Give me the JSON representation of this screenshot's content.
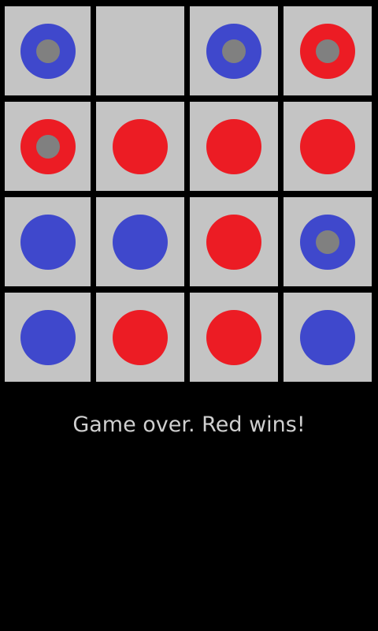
{
  "colors": {
    "background": "#000000",
    "cell": "#c4c4c4",
    "red": "#ec1c24",
    "blue": "#3f48cc",
    "marker": "#808080",
    "status_text": "#cfcfcf"
  },
  "board": {
    "rows": 4,
    "cols": 4,
    "cells": [
      [
        {
          "piece": "blue",
          "marked": true
        },
        {
          "piece": "empty",
          "marked": false
        },
        {
          "piece": "blue",
          "marked": true
        },
        {
          "piece": "red",
          "marked": true
        }
      ],
      [
        {
          "piece": "red",
          "marked": true
        },
        {
          "piece": "red",
          "marked": false
        },
        {
          "piece": "red",
          "marked": false
        },
        {
          "piece": "red",
          "marked": false
        }
      ],
      [
        {
          "piece": "blue",
          "marked": false
        },
        {
          "piece": "blue",
          "marked": false
        },
        {
          "piece": "red",
          "marked": false
        },
        {
          "piece": "blue",
          "marked": true
        }
      ],
      [
        {
          "piece": "blue",
          "marked": false
        },
        {
          "piece": "red",
          "marked": false
        },
        {
          "piece": "red",
          "marked": false
        },
        {
          "piece": "blue",
          "marked": false
        }
      ]
    ]
  },
  "status": {
    "message": "Game over. Red wins!"
  }
}
